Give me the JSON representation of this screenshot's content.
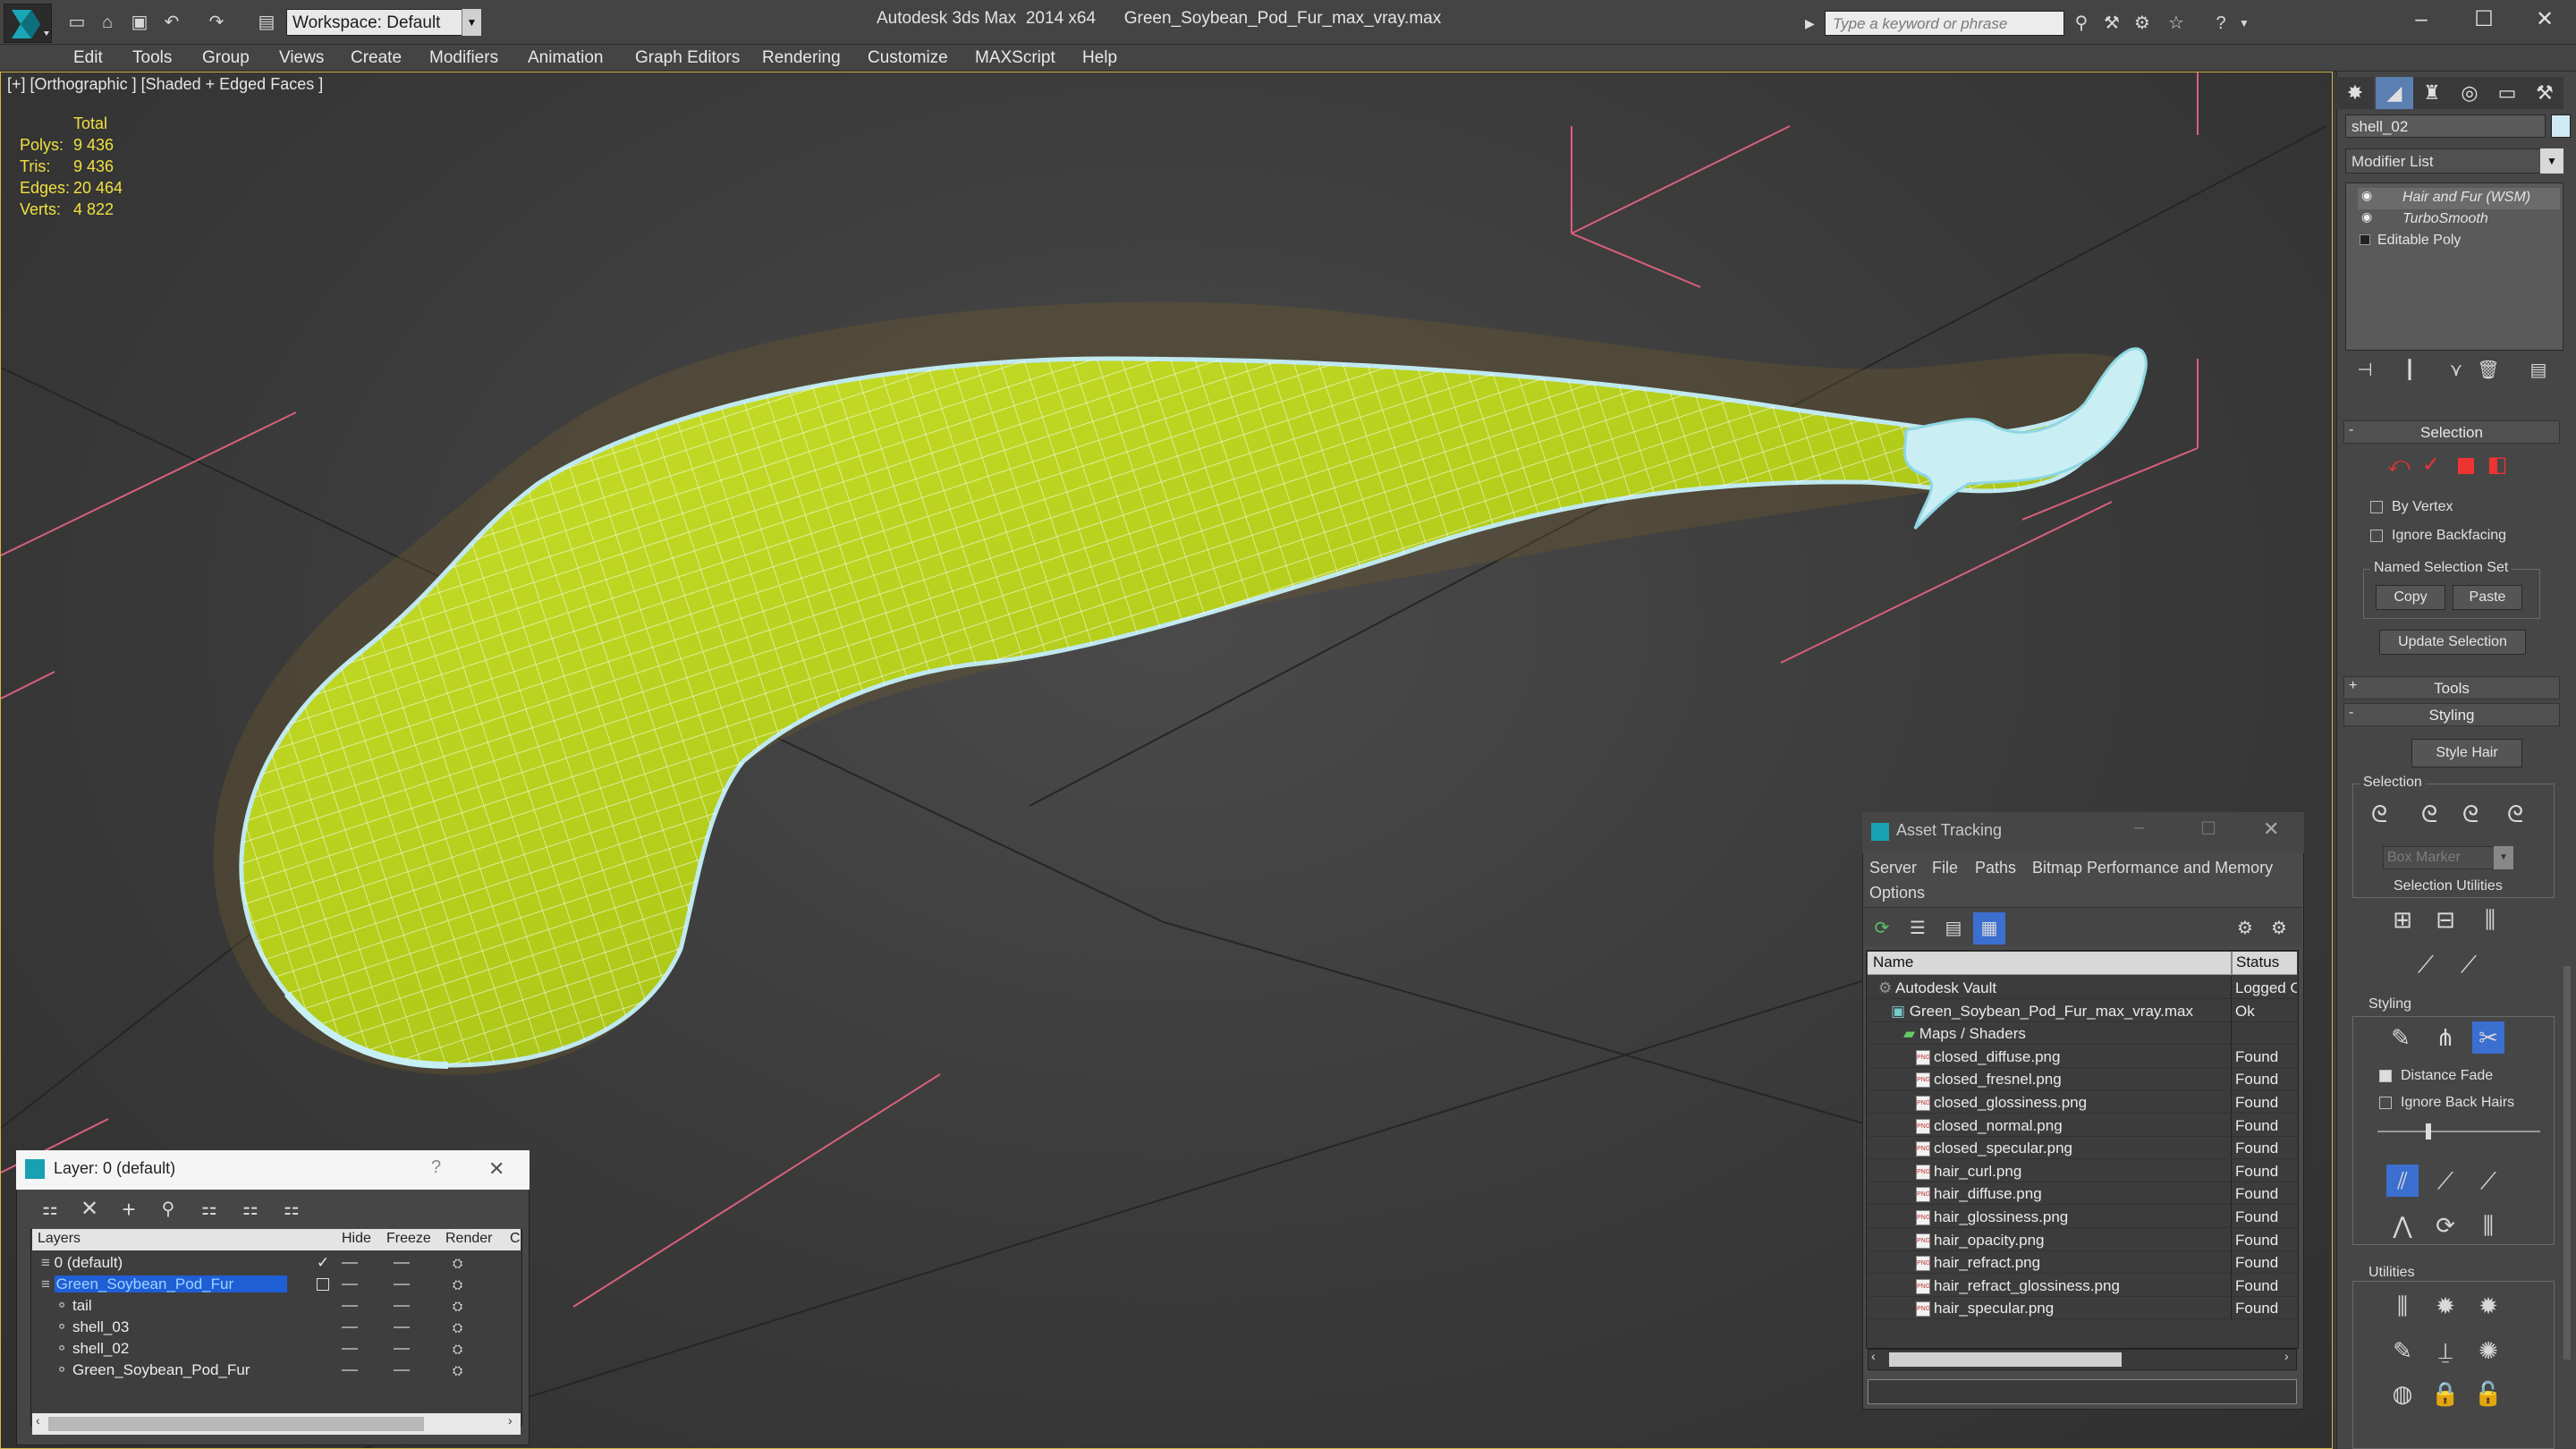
{
  "window": {
    "title": "Autodesk 3ds Max  2014 x64      Green_Soybean_Pod_Fur_max_vray.max",
    "workspace": "Workspace: Default",
    "search_placeholder": "Type a keyword or phrase",
    "minimize": "–",
    "maximize": "☐",
    "close": "✕"
  },
  "menu": [
    "Edit",
    "Tools",
    "Group",
    "Views",
    "Create",
    "Modifiers",
    "Animation",
    "Graph Editors",
    "Rendering",
    "Customize",
    "MAXScript",
    "Help"
  ],
  "viewport": {
    "label": "[+] [Orthographic ] [Shaded + Edged Faces ]",
    "stats": {
      "header": "Total",
      "rows": [
        {
          "label": "Polys:",
          "value": "9 436"
        },
        {
          "label": "Tris:",
          "value": "9 436"
        },
        {
          "label": "Edges:",
          "value": "20 464"
        },
        {
          "label": "Verts:",
          "value": "4 822"
        }
      ]
    }
  },
  "command_panel": {
    "object_name": "shell_02",
    "modifier_list": "Modifier List",
    "stack": [
      "Hair and Fur (WSM)",
      "TurboSmooth",
      "Editable Poly"
    ],
    "selection_rollout": {
      "title": "Selection",
      "by_vertex": "By Vertex",
      "ignore_backfacing": "Ignore Backfacing",
      "named_selection_set": "Named Selection Set",
      "copy": "Copy",
      "paste": "Paste",
      "update_selection": "Update Selection"
    },
    "tools_rollout": "Tools",
    "styling_rollout": {
      "title": "Styling",
      "style_hair": "Style Hair",
      "selection_label": "Selection",
      "box_marker": "Box Marker",
      "selection_utilities": "Selection Utilities",
      "styling_label": "Styling",
      "distance_fade": "Distance Fade",
      "ignore_back_hairs": "Ignore Back Hairs",
      "utilities_label": "Utilities"
    },
    "rollout_expand": "+",
    "rollout_collapse": "-"
  },
  "asset_tracking": {
    "title": "Asset Tracking",
    "menu": [
      "Server",
      "File",
      "Paths",
      "Bitmap Performance and Memory",
      "Options"
    ],
    "columns": {
      "name": "Name",
      "status": "Status"
    },
    "rows": [
      {
        "name": "Autodesk Vault",
        "status": "Logged O",
        "indent": 0
      },
      {
        "name": "Green_Soybean_Pod_Fur_max_vray.max",
        "status": "Ok",
        "indent": 1
      },
      {
        "name": "Maps / Shaders",
        "status": "",
        "indent": 2
      },
      {
        "name": "closed_diffuse.png",
        "status": "Found",
        "indent": 3
      },
      {
        "name": "closed_fresnel.png",
        "status": "Found",
        "indent": 3
      },
      {
        "name": "closed_glossiness.png",
        "status": "Found",
        "indent": 3
      },
      {
        "name": "closed_normal.png",
        "status": "Found",
        "indent": 3
      },
      {
        "name": "closed_specular.png",
        "status": "Found",
        "indent": 3
      },
      {
        "name": "hair_curl.png",
        "status": "Found",
        "indent": 3
      },
      {
        "name": "hair_diffuse.png",
        "status": "Found",
        "indent": 3
      },
      {
        "name": "hair_glossiness.png",
        "status": "Found",
        "indent": 3
      },
      {
        "name": "hair_opacity.png",
        "status": "Found",
        "indent": 3
      },
      {
        "name": "hair_refract.png",
        "status": "Found",
        "indent": 3
      },
      {
        "name": "hair_refract_glossiness.png",
        "status": "Found",
        "indent": 3
      },
      {
        "name": "hair_specular.png",
        "status": "Found",
        "indent": 3
      }
    ],
    "png_icon": "PNG",
    "minimize": "–",
    "maximize": "☐",
    "close": "✕"
  },
  "layer_dialog": {
    "title": "Layer: 0 (default)",
    "help": "?",
    "close": "✕",
    "columns": {
      "layers": "Layers",
      "hide": "Hide",
      "freeze": "Freeze",
      "render": "Render",
      "extra": "C"
    },
    "rows": [
      {
        "name": "0 (default)",
        "indent": 1,
        "selected": false
      },
      {
        "name": "Green_Soybean_Pod_Fur",
        "indent": 1,
        "selected": true
      },
      {
        "name": "tail",
        "indent": 2,
        "selected": false
      },
      {
        "name": "shell_03",
        "indent": 2,
        "selected": false
      },
      {
        "name": "shell_02",
        "indent": 2,
        "selected": false
      },
      {
        "name": "Green_Soybean_Pod_Fur",
        "indent": 2,
        "selected": false
      }
    ]
  },
  "colors": {
    "viewport_border": "#d0b84a",
    "stats_text": "#f0e040",
    "pod_green": "#b5d01e",
    "selection_blue": "#1f5fd6",
    "grid_pink": "#d9607a"
  }
}
